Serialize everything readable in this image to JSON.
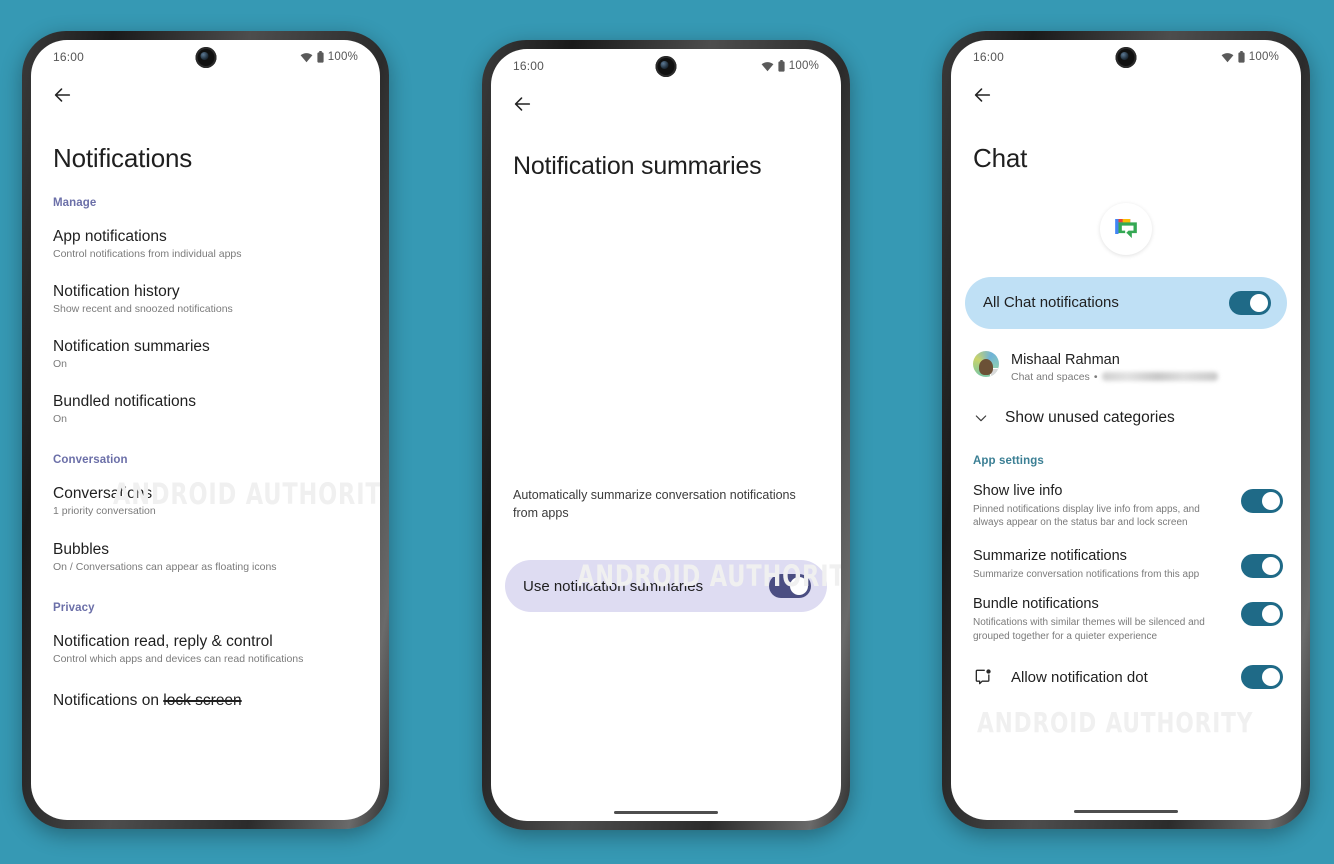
{
  "theme": {
    "background": "#3699b4",
    "accent_purple": "#6b6fa8",
    "accent_teal": "#3b7f94",
    "toggle_teal": "#1f6a87",
    "toggle_purple": "#4b4e82",
    "card_blue": "#bfe0f5",
    "card_lavender": "#dedcf2",
    "watermark_color": "#f0f0f0"
  },
  "watermark": {
    "text": "ANDROID AUTHORITY"
  },
  "statusbar": {
    "time": "16:00",
    "battery_text": "100%",
    "wifi_icon": "wifi-icon",
    "battery_icon": "battery-icon",
    "camera_icon": "front-camera-punch-hole"
  },
  "phone1": {
    "back_icon": "back-arrow-icon",
    "title": "Notifications",
    "sections": [
      {
        "header": "Manage",
        "items": [
          {
            "title": "App notifications",
            "subtitle": "Control notifications from individual apps"
          },
          {
            "title": "Notification history",
            "subtitle": "Show recent and snoozed notifications"
          },
          {
            "title": "Notification summaries",
            "subtitle": "On"
          },
          {
            "title": "Bundled notifications",
            "subtitle": "On"
          }
        ]
      },
      {
        "header": "Conversation",
        "items": [
          {
            "title": "Conversations",
            "subtitle": "1 priority conversation"
          },
          {
            "title": "Bubbles",
            "subtitle": "On / Conversations can appear as floating icons"
          }
        ]
      },
      {
        "header": "Privacy",
        "items": [
          {
            "title": "Notification read, reply & control",
            "subtitle": "Control which apps and devices can read notifications"
          }
        ]
      }
    ],
    "cutoff_item": {
      "prefix": "Notifications on ",
      "struck": "lock screen"
    }
  },
  "phone2": {
    "back_icon": "back-arrow-icon",
    "title": "Notification summaries",
    "description": "Automatically summarize conversation notifications from apps",
    "toggle_card": {
      "label": "Use notification summaries",
      "state": "on",
      "card_color": "#dedcf2",
      "track_color": "#4b4e82"
    }
  },
  "phone3": {
    "back_icon": "back-arrow-icon",
    "title": "Chat",
    "app_icon": "google-chat-icon",
    "master_toggle": {
      "label": "All Chat notifications",
      "state": "on",
      "card_color": "#bfe0f5",
      "track_color": "#1f6a87"
    },
    "person": {
      "name": "Mishaal Rahman",
      "subtitle_prefix": "Chat and spaces",
      "separator": "•",
      "subtitle_redacted": true,
      "avatar_icon": "user-avatar"
    },
    "expand_row": {
      "label": "Show unused categories",
      "icon": "chevron-down-icon"
    },
    "app_settings_header": "App settings",
    "settings": [
      {
        "title": "Show live info",
        "subtitle": "Pinned notifications display live info from apps, and always appear on the status bar and lock screen",
        "state": "on"
      },
      {
        "title": "Summarize notifications",
        "subtitle": "Summarize conversation notifications from this app",
        "state": "on"
      },
      {
        "title": "Bundle notifications",
        "subtitle": "Notifications with similar themes will be silenced and grouped together for a quieter experience",
        "state": "on"
      }
    ],
    "notification_dot": {
      "label": "Allow notification dot",
      "icon": "notification-dot-icon",
      "state": "on"
    }
  }
}
